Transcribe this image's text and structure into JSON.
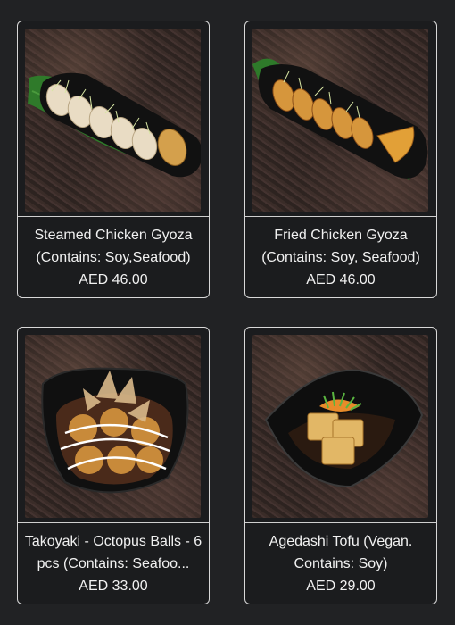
{
  "menu": {
    "items": [
      {
        "name": "Steamed Chicken Gyoza (Contains: Soy,Seafood)",
        "price": "AED 46.00",
        "image_icon": "steamed-gyoza-image"
      },
      {
        "name": "Fried Chicken Gyoza (Contains: Soy, Seafood)",
        "price": "AED 46.00",
        "image_icon": "fried-gyoza-image"
      },
      {
        "name": "Takoyaki - Octopus Balls - 6 pcs (Contains: Seafoo...",
        "price": "AED 33.00",
        "image_icon": "takoyaki-image"
      },
      {
        "name": "Agedashi Tofu (Vegan. Contains: Soy)",
        "price": "AED 29.00",
        "image_icon": "agedashi-tofu-image"
      }
    ]
  },
  "colors": {
    "background": "#212224",
    "card_border": "#d8d8d8",
    "text": "#f1f1f1"
  }
}
